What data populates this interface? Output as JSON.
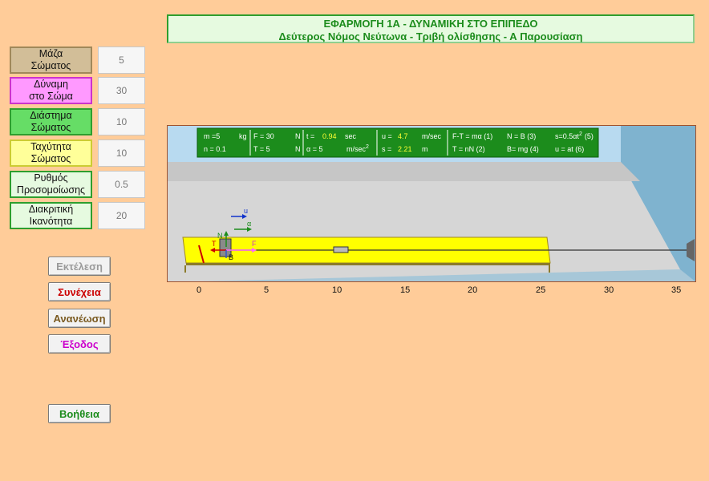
{
  "title": {
    "line1": "ΕΦΑΡΜΟΓΗ 1Α - ΔΥΝΑΜΙΚΗ ΣΤΟ ΕΠΙΠΕΔΟ",
    "line2": "Δεύτερος Νόμος Νεύτωνα - Τριβή ολίσθησης - Α Παρουσίαση"
  },
  "params": [
    {
      "label1": "Μάζα",
      "label2": "Σώματος",
      "value": "5",
      "bg": "#D2BE98",
      "border": "#A0885A"
    },
    {
      "label1": "Δύναμη",
      "label2": "στο Σώμα",
      "value": "30",
      "bg": "#FF99FF",
      "border": "#CC33CC"
    },
    {
      "label1": "Διάστημα",
      "label2": "Σώματος",
      "value": "10",
      "bg": "#66DD66",
      "border": "#2E9E2E"
    },
    {
      "label1": "Ταχύτητα",
      "label2": "Σώματος",
      "value": "10",
      "bg": "#FFFF99",
      "border": "#CCCC33"
    },
    {
      "label1": "Ρυθμός",
      "label2": "Προσομοίωσης",
      "value": "0.5",
      "bg": "#E6FAE0",
      "border": "#2E9E2E"
    },
    {
      "label1": "Διακριτική",
      "label2": "Ικανότητα",
      "value": "20",
      "bg": "#E6FAE0",
      "border": "#2E9E2E"
    }
  ],
  "buttons": [
    {
      "label": "Εκτέλεση",
      "color": "#9a9a9a"
    },
    {
      "label": "Συνέχεια",
      "color": "#CC0000"
    },
    {
      "label": "Ανανέωση",
      "color": "#7A5A20"
    },
    {
      "label": "Έξοδος",
      "color": "#CC00CC"
    },
    {
      "label": "Βοήθεια",
      "color": "#1C8C1C"
    }
  ],
  "readouts": {
    "m_label": "m =5",
    "m_unit": "kg",
    "F_label": "F = 30",
    "F_unit": "N",
    "t_label": "t =",
    "t_val": "0.94",
    "t_unit": "sec",
    "u_label": "u =",
    "u_val": "4.7",
    "u_unit": "m/sec",
    "n_label": "n = 0.1",
    "T_label": "T = 5",
    "T_unit": "N",
    "a_label": "α = 5",
    "a_unit": "m/sec",
    "s_label": "s =",
    "s_val": "2.21",
    "s_unit": "m",
    "eq1": "F-T = mα (1)",
    "eq2": "N = B (3)",
    "eq3": "s=0.5αt",
    "eq3_sup": "2",
    "eq3_num": "(5)",
    "eq4": "T = nN (2)",
    "eq5": "B= mg (4)",
    "eq6": "u = at  (6)"
  },
  "vectors": {
    "u": "u",
    "a": "α",
    "N": "N",
    "T": "T",
    "F": "F",
    "B": "B"
  },
  "ruler": [
    "0",
    "5",
    "10",
    "15",
    "20",
    "25",
    "30",
    "35"
  ],
  "colors": {
    "accent": "#1C8C1C",
    "background": "#FFCC99",
    "board": "#FFFF00"
  }
}
